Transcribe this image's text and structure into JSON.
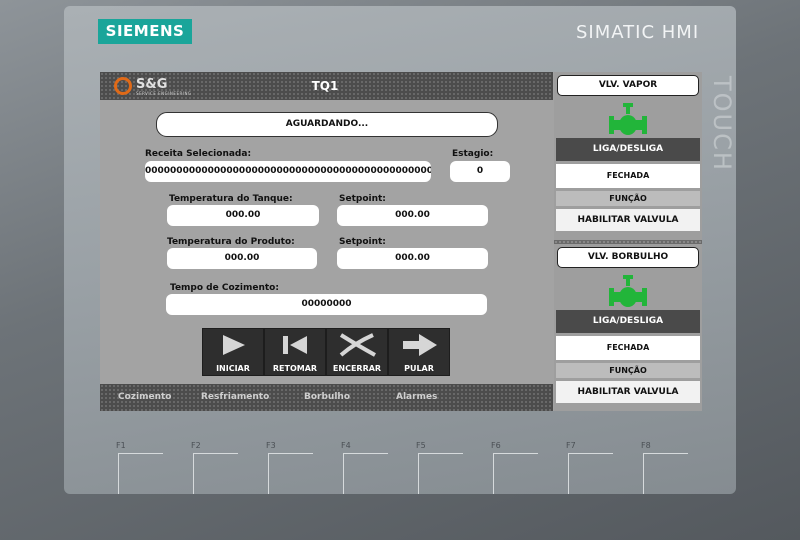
{
  "device": {
    "brand": "SIEMENS",
    "model": "SIMATIC HMI",
    "side_text": "TOUCH",
    "function_keys": [
      "F1",
      "F2",
      "F3",
      "F4",
      "F5",
      "F6",
      "F7",
      "F8"
    ]
  },
  "header": {
    "logo_text": "S&G",
    "logo_subtext": "SERVICE ENGINEERING",
    "title": "TQ1"
  },
  "main": {
    "status": "AGUARDANDO...",
    "recipe_label": "Receita Selecionada:",
    "recipe_value": "0000000000000000000000000000000000000000000000000",
    "stage_label": "Estagio:",
    "stage_value": "0",
    "tank_temp_label": "Temperatura do Tanque:",
    "tank_temp_value": "000.00",
    "tank_setpoint_label": "Setpoint:",
    "tank_setpoint_value": "000.00",
    "product_temp_label": "Temperatura do Produto:",
    "product_temp_value": "000.00",
    "product_setpoint_label": "Setpoint:",
    "product_setpoint_value": "000.00",
    "cook_time_label": "Tempo de Cozimento:",
    "cook_time_value": "00000000"
  },
  "controls": {
    "start": "INICIAR",
    "resume": "RETOMAR",
    "finish": "ENCERRAR",
    "skip": "PULAR"
  },
  "footer": {
    "tabs": [
      "Cozimento",
      "Resfriamento",
      "Borbulho",
      "Alarmes"
    ]
  },
  "valves": [
    {
      "title": "VLV. VAPOR",
      "toggle": "LIGA/DESLIGA",
      "state": "FECHADA",
      "function_label": "FUNÇÃO",
      "enable": "HABILITAR VALVULA"
    },
    {
      "title": "VLV. BORBULHO",
      "toggle": "LIGA/DESLIGA",
      "state": "FECHADA",
      "function_label": "FUNÇÃO",
      "enable": "HABILITAR VALVULA"
    }
  ],
  "colors": {
    "brand_teal": "#1aa59a",
    "logo_orange": "#e06a18",
    "valve_green": "#22b53a",
    "screen_bg": "#a3a3a3",
    "bar_dark": "#4c4c4c"
  }
}
